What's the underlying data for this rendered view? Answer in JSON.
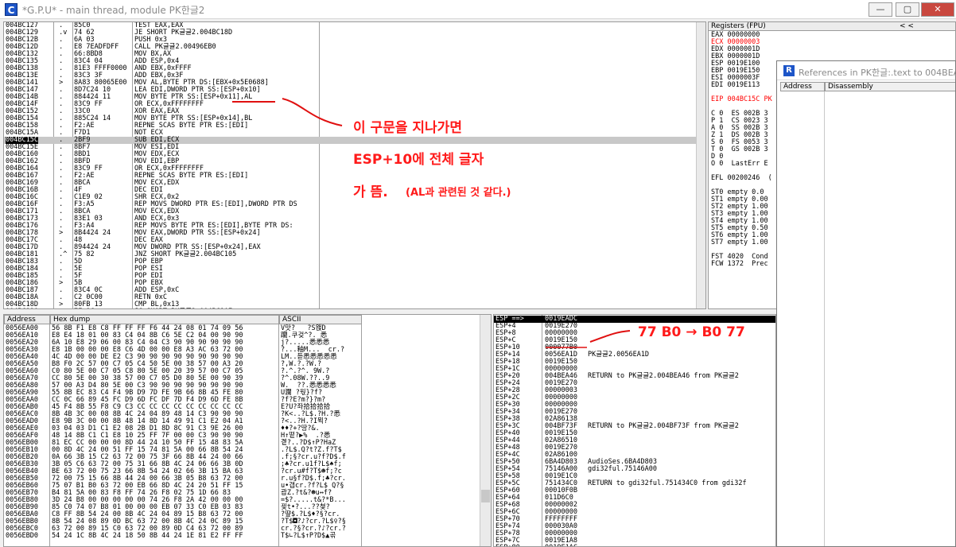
{
  "window": {
    "title": "*G.P.U* - main thread, module PK한글2",
    "app_icon": "C"
  },
  "controls": {
    "minimize": "—",
    "maximize": "▢",
    "close": "✕"
  },
  "disasm": {
    "rows": [
      {
        "a": "004BC127",
        "m": " .",
        "h": "85C0",
        "i": "TEST EAX,EAX"
      },
      {
        "a": "004BC129",
        "m": " .v",
        "h": "74 62",
        "i": "JE SHORT PK글글2.004BC18D"
      },
      {
        "a": "004BC12B",
        "m": " .",
        "h": "6A 03",
        "i": "PUSH 0x3"
      },
      {
        "a": "004BC12D",
        "m": " .",
        "h": "E8 7EADFDFF",
        "i": "CALL PK글글2.00496EB0"
      },
      {
        "a": "004BC132",
        "m": " .",
        "h": "66:8BD8",
        "i": "MOV BX,AX"
      },
      {
        "a": "004BC135",
        "m": " .",
        "h": "83C4 04",
        "i": "ADD ESP,0x4"
      },
      {
        "a": "004BC138",
        "m": " .",
        "h": "81E3 FFFF0000",
        "i": "AND EBX,0xFFFF"
      },
      {
        "a": "004BC13E",
        "m": " .",
        "h": "83C3 3F",
        "i": "ADD EBX,0x3F"
      },
      {
        "a": "004BC141",
        "m": " >",
        "h": "8A83 80065E00",
        "i": "MOV AL,BYTE PTR DS:[EBX+0x5E0688]"
      },
      {
        "a": "004BC147",
        "m": " .",
        "h": "8D7C24 10",
        "i": "LEA EDI,DWORD PTR SS:[ESP+0x10]"
      },
      {
        "a": "004BC14B",
        "m": " .",
        "h": "884424 11",
        "i": "MOV BYTE PTR SS:[ESP+0x11],AL"
      },
      {
        "a": "004BC14F",
        "m": " .",
        "h": "83C9 FF",
        "i": "OR ECX,0xFFFFFFFF"
      },
      {
        "a": "004BC152",
        "m": " .",
        "h": "33C0",
        "i": "XOR EAX,EAX"
      },
      {
        "a": "004BC154",
        "m": " .",
        "h": "885C24 14",
        "i": "MOV BYTE PTR SS:[ESP+0x14],BL"
      },
      {
        "a": "004BC158",
        "m": " .",
        "h": "F2:AE",
        "i": "REPNE SCAS BYTE PTR ES:[EDI]"
      },
      {
        "a": "004BC15A",
        "m": " .",
        "h": "F7D1",
        "i": "NOT ECX"
      },
      {
        "a": "004BC15C",
        "m": " .",
        "h": "2BF9",
        "i": "SUB EDI,ECX"
      },
      {
        "a": "004BC15E",
        "m": " .",
        "h": "8BF7",
        "i": "MOV ESI,EDI"
      },
      {
        "a": "004BC160",
        "m": " .",
        "h": "8BD1",
        "i": "MOV EDX,ECX"
      },
      {
        "a": "004BC162",
        "m": " .",
        "h": "8BFD",
        "i": "MOV EDI,EBP"
      },
      {
        "a": "004BC164",
        "m": " .",
        "h": "83C9 FF",
        "i": "OR ECX,0xFFFFFFFF"
      },
      {
        "a": "004BC167",
        "m": " .",
        "h": "F2:AE",
        "i": "REPNE SCAS BYTE PTR ES:[EDI]"
      },
      {
        "a": "004BC169",
        "m": " .",
        "h": "8BCA",
        "i": "MOV ECX,EDX"
      },
      {
        "a": "004BC16B",
        "m": " .",
        "h": "4F",
        "i": "DEC EDI"
      },
      {
        "a": "004BC16C",
        "m": " .",
        "h": "C1E9 02",
        "i": "SHR ECX,0x2"
      },
      {
        "a": "004BC16F",
        "m": " .",
        "h": "F3:A5",
        "i": "REP MOVS DWORD PTR ES:[EDI],DWORD PTR DS"
      },
      {
        "a": "004BC171",
        "m": " .",
        "h": "8BCA",
        "i": "MOV ECX,EDX"
      },
      {
        "a": "004BC173",
        "m": " .",
        "h": "83E1 03",
        "i": "AND ECX,0x3"
      },
      {
        "a": "004BC176",
        "m": " .",
        "h": "F3:A4",
        "i": "REP MOVS BYTE PTR ES:[EDI],BYTE PTR DS:"
      },
      {
        "a": "004BC178",
        "m": " >",
        "h": "8B4424 24",
        "i": "MOV EAX,DWORD PTR SS:[ESP+0x24]"
      },
      {
        "a": "004BC17C",
        "m": " .",
        "h": "48",
        "i": "DEC EAX"
      },
      {
        "a": "004BC17D",
        "m": " .",
        "h": "894424 24",
        "i": "MOV DWORD PTR SS:[ESP+0x24],EAX"
      },
      {
        "a": "004BC181",
        "m": " .^",
        "h": "75 82",
        "i": "JNZ SHORT PK글글2.004BC105"
      },
      {
        "a": "004BC183",
        "m": " .",
        "h": "5D",
        "i": "POP EBP"
      },
      {
        "a": "004BC184",
        "m": " .",
        "h": "5E",
        "i": "POP ESI"
      },
      {
        "a": "004BC185",
        "m": " .",
        "h": "5F",
        "i": "POP EDI"
      },
      {
        "a": "004BC186",
        "m": " >",
        "h": "5B",
        "i": "POP EBX"
      },
      {
        "a": "004BC187",
        "m": " .",
        "h": "83C4 0C",
        "i": "ADD ESP,0xC"
      },
      {
        "a": "004BC18A",
        "m": " .",
        "h": "C2 0C00",
        "i": "RETN 0xC"
      },
      {
        "a": "004BC18D",
        "m": " >",
        "h": "80FB 13",
        "i": "CMP BL,0x13"
      },
      {
        "a": "004BC190",
        "m": " .",
        "h": "7F 1C",
        "i": "JG SHORT PK글글2.004BC1AE"
      }
    ],
    "selected_index": 16
  },
  "registers": {
    "title": "Registers (FPU)",
    "nav": "<        <",
    "rows": [
      {
        "t": "EAX 00000000",
        "c": ""
      },
      {
        "t": "ECX 00000003",
        "c": "red"
      },
      {
        "t": "EDX 0000001D",
        "c": ""
      },
      {
        "t": "EBX 0000001D",
        "c": ""
      },
      {
        "t": "ESP 0019E100",
        "c": ""
      },
      {
        "t": "EBP 0019E150",
        "c": ""
      },
      {
        "t": "ESI 0000003F",
        "c": ""
      },
      {
        "t": "EDI 0019E113",
        "c": ""
      },
      {
        "t": "",
        "c": ""
      },
      {
        "t": "EIP 004BC15C PK",
        "c": "red"
      },
      {
        "t": "",
        "c": ""
      },
      {
        "t": "C 0  ES 002B 3",
        "c": ""
      },
      {
        "t": "P 1  CS 0023 3",
        "c": ""
      },
      {
        "t": "A 0  SS 002B 3",
        "c": ""
      },
      {
        "t": "Z 1  DS 002B 3",
        "c": ""
      },
      {
        "t": "S 0  FS 0053 3",
        "c": ""
      },
      {
        "t": "T 0  GS 002B 3",
        "c": ""
      },
      {
        "t": "D 0",
        "c": ""
      },
      {
        "t": "O 0  LastErr E",
        "c": ""
      },
      {
        "t": "",
        "c": ""
      },
      {
        "t": "EFL 00200246  (",
        "c": ""
      },
      {
        "t": "",
        "c": ""
      },
      {
        "t": "ST0 empty 0.0",
        "c": ""
      },
      {
        "t": "ST1 empty 0.00",
        "c": ""
      },
      {
        "t": "ST2 empty 1.00",
        "c": ""
      },
      {
        "t": "ST3 empty 1.00",
        "c": ""
      },
      {
        "t": "ST4 empty 1.00",
        "c": ""
      },
      {
        "t": "ST5 empty 0.50",
        "c": ""
      },
      {
        "t": "ST6 empty 1.00",
        "c": ""
      },
      {
        "t": "ST7 empty 1.00",
        "c": ""
      },
      {
        "t": "",
        "c": ""
      },
      {
        "t": "FST 4020  Cond",
        "c": ""
      },
      {
        "t": "FCW 1372  Prec",
        "c": ""
      }
    ]
  },
  "references": {
    "icon": "R",
    "title": "References in PK한글:.text to 004BEA",
    "col_address": "Address",
    "col_disassembly": "Disassembly"
  },
  "dump": {
    "col_address": "Address",
    "col_hex": "Hex dump",
    "col_ascii": "ASCII",
    "rows": [
      {
        "a": "0056EA00",
        "h": "56 8B F1 E8 C8 FF FF FF F6 44 24 08 01 74 09 56",
        "s": "V맛?   ?S왡D"
      },
      {
        "a": "0056EA10",
        "h": "E8 E4 18 01 00 83 C4 04 8B C6 5E C2 04 00 90 90",
        "s": "躪\u0001.쿠겆^?. 悉"
      },
      {
        "a": "0056EA20",
        "h": "6A 10 E8 29 06 00 83 C4 04 C3 90 90 90 90 90 90",
        "s": "j\u0010?.....悉悉悉"
      },
      {
        "a": "0056EA30",
        "h": "E8 1B 00 00 00 E8 C6 4D 00 00 E8 A3 AC 63 72 00",
        "s": "?...釉M...  cr.?"
      },
      {
        "a": "0056EA40",
        "h": "4C 4D 00 00 DE E2 C3 90 90 90 90 90 90 90 90 90",
        "s": "LM..듣悉悉悉悉悉"
      },
      {
        "a": "0056EA50",
        "h": "B8 F0 2C 57 00 C7 05 C4 50 5E 00 38 57 00 A3 20",
        "s": "?,W.?.?W.?"
      },
      {
        "a": "0056EA60",
        "c": "",
        "h": "C0 80 5E 00 C7 05 C8 80 5E 00 20 39 57 00 C7 05",
        "s": "?.^.?^. 9W.?"
      },
      {
        "a": "0056EA70",
        "h": "CC 80 5E 00 30 38 57 00 C7 05 D0 80 5E 00 90 39",
        "s": "?^.08W.??..9"
      },
      {
        "a": "0056EA80",
        "h": "57 00 A3 D4 80 5E 00 C3 90 90 90 90 90 90 90 90",
        "s": "W.  ??.悉悉悉悉"
      },
      {
        "a": "0056EA90",
        "h": "55 8B EC 83 C4 F4 9B D9 7D FE 9B 66 8B 45 FE 80",
        "s": "U瀾 ?웏}?f?"
      },
      {
        "a": "0056EAA0",
        "h": "CC 0C 66 89 45 FC D9 6D FC DF 7D F4 D9 6D FE 8B",
        "s": "?f?E?m?}?m?"
      },
      {
        "a": "0056EAB0",
        "h": "45 F4 8B 55 F8 C9 C3 CC CC CC CC CC CC CC CC CC",
        "s": "E?U?좌拾拾拾拾"
      },
      {
        "a": "0056EAC0",
        "h": "8B 4B 3C 00 08 8B 4C 24 04 89 48 14 C3 90 90 90",
        "s": "?K<..?L$.?H.?悉"
      },
      {
        "a": "0056EAD0",
        "h": "E8 9B 3C 00 00 8B 48 14 8D 14 49 91 C1 E2 04 A1",
        "s": "?<..?H.?I뮉?"
      },
      {
        "a": "0056EAE0",
        "h": "03 04 03 D1 C1 E2 08 2B D1 8D 8C 91 C3 9E 26 00",
        "s": "♦♦?+?땅?&."
      },
      {
        "a": "0056EAF0",
        "h": "48 14 8B C1 C1 E8 10 25 FF 7F 00 00 C3 90 90 90",
        "s": "H↑떹?▶%  .?悉"
      },
      {
        "a": "0056EB00",
        "h": "81 EC CC 00 00 00 8D 44 24 10 50 FF 15 48 83 5A",
        "s": "곝?..?D$↑P?HaZ"
      },
      {
        "a": "0056EB10",
        "h": "00 8D 4C 24 00 51 FF 15 74 81 5A 00 66 8B 54 24",
        "s": ".?L$.Q?t?Z.f?T$"
      },
      {
        "a": "0056EB20",
        "h": "0A 66 3B 15 C2 63 72 00 75 3F 66 8B 44 24 00 66",
        "s": ".f;§?cr.u?f?D$.f"
      },
      {
        "a": "0056EB30",
        "h": "3B 05 C6 63 72 00 75 31 66 8B 4C 24 06 66 3B 0D",
        "s": ";♣?cr.u1f?L$♠f;"
      },
      {
        "a": "0056EB40",
        "h": "BE 63 72 00 75 23 66 8B 54 24 02 66 3B 15 BA 63",
        "s": "?cr.u#f?T$☻f;?c"
      },
      {
        "a": "0056EB50",
        "h": "72 00 75 15 66 8B 44 24 00 66 3B 05 B8 63 72 00",
        "s": "r.u§f?D$.f;♣?cr."
      },
      {
        "a": "0056EB60",
        "h": "75 07 B1 B0 63 72 00 EB 66 8D 4C 24 20 51 FF 15",
        "s": "u•갭cr.?f?L$ Q?§"
      },
      {
        "a": "0056EB70",
        "h": "B4 81 5A 00 83 F8 FF 74 26 F8 02 75 1D 66 83",
        "s": "괍Z.?t&?☻u↔f?"
      },
      {
        "a": "0056EB80",
        "h": "3D 24 B8 00 00 00 00 00 74 26 F8 2A 42 00 00 00",
        "s": "=$?.....t&?*B..."
      },
      {
        "a": "0056EB90",
        "h": "85 C0 74 07 B8 01 00 00 00 EB 07 33 C0 EB 03 83",
        "s": "끷t•?...??쳦?"
      },
      {
        "a": "0056EBA0",
        "h": "C8 FF 8B 54 24 00 8B 4C 24 04 89 15 B8 63 72 00",
        "s": "?떂$.?L$♦?§?cr."
      },
      {
        "a": "0056EBB0",
        "h": "8B 54 24 08 89 0D BC 63 72 00 8B 4C 24 0C 89 15",
        "s": "?T$◘?♪?cr.?L$♀?§"
      },
      {
        "a": "0056EBC0",
        "h": "63 72 00 89 15 C0 63 72 00 89 0D C4 63 72 00 89",
        "s": "cr.?§?cr.?♪?cr.?"
      },
      {
        "a": "0056EBD0",
        "h": "54 24 1C 8B 4C 24 18 50 8B 44 24 1E 81 E2 FF FF",
        "s": "T$∟?L$↑P?D$▲곢"
      }
    ]
  },
  "stack": {
    "rows": [
      {
        "a": "ESP ==>",
        "v": "0019EADC",
        "c": ""
      },
      {
        "a": "ESP+4",
        "v": "0019E270",
        "c": ""
      },
      {
        "a": "ESP+8",
        "v": "00000000",
        "c": ""
      },
      {
        "a": "ESP+C",
        "v": "0019E150",
        "c": ""
      },
      {
        "a": "ESP+10",
        "v": "000077B0",
        "c": ""
      },
      {
        "a": "ESP+14",
        "v": "0056EA1D",
        "c": "PK글글2.0056EA1D"
      },
      {
        "a": "ESP+18",
        "v": "0019E150",
        "c": ""
      },
      {
        "a": "ESP+1C",
        "v": "00000000",
        "c": ""
      },
      {
        "a": "ESP+20",
        "v": "004BEA46",
        "c": "RETURN to PK글글2.004BEA46 from PK글글2"
      },
      {
        "a": "ESP+24",
        "v": "0019E270",
        "c": ""
      },
      {
        "a": "ESP+28",
        "v": "00000003",
        "c": ""
      },
      {
        "a": "ESP+2C",
        "v": "00000000",
        "c": ""
      },
      {
        "a": "ESP+30",
        "v": "00000000",
        "c": ""
      },
      {
        "a": "ESP+34",
        "v": "0019E270",
        "c": ""
      },
      {
        "a": "ESP+38",
        "v": "02A86138",
        "c": ""
      },
      {
        "a": "ESP+3C",
        "v": "004BF73F",
        "c": "RETURN to PK글글2.004BF73F from PK글글2"
      },
      {
        "a": "ESP+40",
        "v": "0019E150",
        "c": ""
      },
      {
        "a": "ESP+44",
        "v": "02A86510",
        "c": ""
      },
      {
        "a": "ESP+48",
        "v": "0019E270",
        "c": ""
      },
      {
        "a": "ESP+4C",
        "v": "02A86100",
        "c": ""
      },
      {
        "a": "ESP+50",
        "v": "6BA4D803",
        "c": "AudioSes.6BA4D803"
      },
      {
        "a": "ESP+54",
        "v": "75146A00",
        "c": "gdi32ful.75146A00"
      },
      {
        "a": "ESP+58",
        "v": "0019E1C0",
        "c": ""
      },
      {
        "a": "ESP+5C",
        "v": "751434C0",
        "c": "RETURN to gdi32ful.751434C0 from gdi32f"
      },
      {
        "a": "ESP+60",
        "v": "00010F0B",
        "c": ""
      },
      {
        "a": "ESP+64",
        "v": "011D6C0",
        "c": ""
      },
      {
        "a": "ESP+68",
        "v": "00000002",
        "c": ""
      },
      {
        "a": "ESP+6C",
        "v": "00000000",
        "c": ""
      },
      {
        "a": "ESP+70",
        "v": "FFFFFFFF",
        "c": ""
      },
      {
        "a": "ESP+74",
        "v": "000030A0",
        "c": ""
      },
      {
        "a": "ESP+78",
        "v": "00000000",
        "c": ""
      },
      {
        "a": "ESP+7C",
        "v": "0019E1A8",
        "c": ""
      },
      {
        "a": "ESP+80",
        "v": "0019E1AC",
        "c": ""
      }
    ]
  },
  "annotations": {
    "line1": "이 구문을 지나가면",
    "line2": "ESP+10에 전체 글자",
    "line3": "가 뜸.",
    "line3_small": "(AL과 관련된 것 같다.)",
    "byteswap": "77 B0 → B0 77"
  }
}
